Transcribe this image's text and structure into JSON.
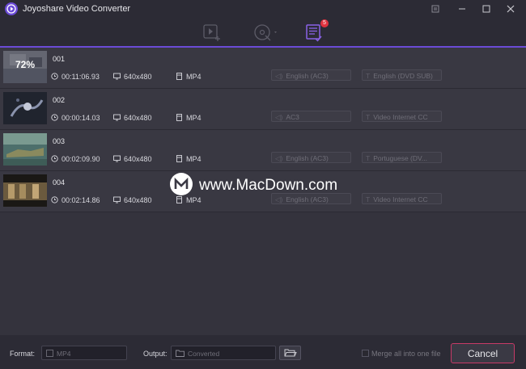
{
  "window": {
    "title": "Joyoshare Video Converter"
  },
  "toolbar": {
    "list_badge": "5"
  },
  "files": [
    {
      "name": "001",
      "duration": "00:11:06.93",
      "resolution": "640x480",
      "format": "MP4",
      "audio": "English (AC3)",
      "subtitle": "English (DVD SUB)",
      "progress_label": "72%"
    },
    {
      "name": "002",
      "duration": "00:00:14.03",
      "resolution": "640x480",
      "format": "MP4",
      "audio": "AC3",
      "subtitle": "Video Internet CC",
      "progress_label": ""
    },
    {
      "name": "003",
      "duration": "00:02:09.90",
      "resolution": "640x480",
      "format": "MP4",
      "audio": "English (AC3)",
      "subtitle": "Portuguese (DV...",
      "progress_label": ""
    },
    {
      "name": "004",
      "duration": "00:02:14.86",
      "resolution": "640x480",
      "format": "MP4",
      "audio": "English (AC3)",
      "subtitle": "Video Internet CC",
      "progress_label": ""
    }
  ],
  "bottom": {
    "format_label": "Format:",
    "format_value": "MP4",
    "output_label": "Output:",
    "output_value": "Converted",
    "merge_label": "Merge all into one file",
    "cancel_label": "Cancel"
  },
  "watermark": {
    "text": "www.MacDown.com"
  },
  "colors": {
    "accent": "#6b4bd6",
    "cancel_border": "#c73a67",
    "badge": "#e0323f"
  },
  "icons": {
    "app": "joyoshare-logo-icon",
    "add_video": "add-video-icon",
    "add_dvd": "add-dvd-icon",
    "convert_list": "convert-list-icon",
    "clock": "clock-icon",
    "monitor": "monitor-icon",
    "file": "file-icon",
    "audio": "audio-icon",
    "subtitle": "subtitle-icon",
    "folder": "folder-icon"
  }
}
